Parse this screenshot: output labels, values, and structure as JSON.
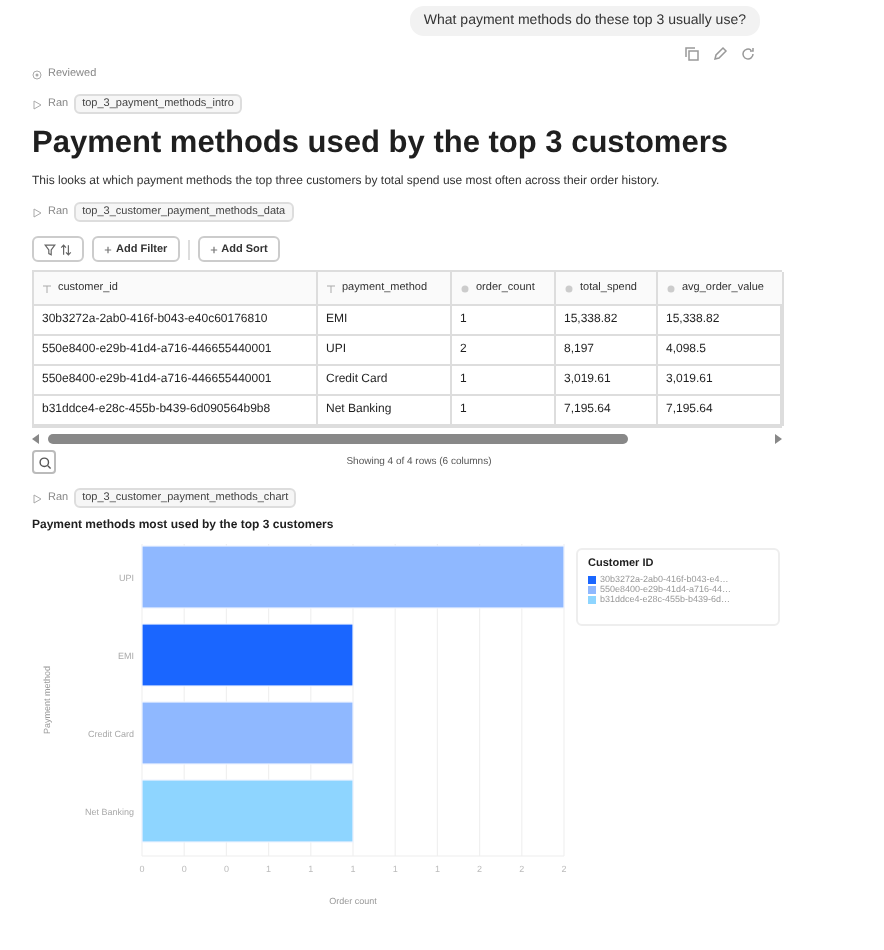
{
  "user_message": "What payment methods do these top 3 usually use?",
  "status": "Reviewed",
  "runs": [
    {
      "label": "Ran",
      "name": "top_3_payment_methods_intro"
    },
    {
      "label": "Ran",
      "name": "top_3_customer_payment_methods_data"
    },
    {
      "label": "Ran",
      "name": "top_3_customer_payment_methods_chart"
    }
  ],
  "heading": "Payment methods used by the top 3 customers",
  "intro": "This looks at which payment methods the top three customers by total spend use most often across their order history.",
  "toolbar": {
    "add_filter": "Add Filter",
    "add_sort": "Add Sort"
  },
  "table": {
    "columns": [
      {
        "name": "customer_id",
        "kind": "text"
      },
      {
        "name": "payment_method",
        "kind": "text"
      },
      {
        "name": "order_count",
        "kind": "number"
      },
      {
        "name": "total_spend",
        "kind": "number"
      },
      {
        "name": "avg_order_value",
        "kind": "number"
      }
    ],
    "rows": [
      [
        "30b3272a-2ab0-416f-b043-e40c60176810",
        "EMI",
        "1",
        "15,338.82",
        "15,338.82"
      ],
      [
        "550e8400-e29b-41d4-a716-446655440001",
        "UPI",
        "2",
        "8,197",
        "4,098.5"
      ],
      [
        "550e8400-e29b-41d4-a716-446655440001",
        "Credit Card",
        "1",
        "3,019.61",
        "3,019.61"
      ],
      [
        "b31ddce4-e28c-455b-b439-6d090564b9b8",
        "Net Banking",
        "1",
        "7,195.64",
        "7,195.64"
      ]
    ]
  },
  "table_footer": "Showing 4 of 4 rows (6 columns)",
  "chart_data": {
    "type": "bar",
    "orientation": "horizontal",
    "stacked": true,
    "title": "Payment methods most used by the top 3 customers",
    "xlabel": "Order count",
    "ylabel": "Payment method",
    "legend_title": "Customer ID",
    "categories": [
      "UPI",
      "EMI",
      "Credit Card",
      "Net Banking"
    ],
    "series": [
      {
        "name": "30b3272a-2ab0-416f-b043-e4…",
        "color": "#1a66ff",
        "values": [
          null,
          1,
          null,
          null
        ]
      },
      {
        "name": "550e8400-e29b-41d4-a716-44…",
        "color": "#8fb8ff",
        "values": [
          2,
          null,
          1,
          null
        ]
      },
      {
        "name": "b31ddce4-e28c-455b-b439-6d…",
        "color": "#8ed5ff",
        "values": [
          null,
          null,
          null,
          1
        ]
      }
    ],
    "xlim": [
      0,
      2
    ],
    "grid": true,
    "xticks": [
      {
        "value": 0,
        "label": "0"
      },
      {
        "value": 0.2,
        "label": "0"
      },
      {
        "value": 0.4,
        "label": "0"
      },
      {
        "value": 0.6,
        "label": "1"
      },
      {
        "value": 0.8,
        "label": "1"
      },
      {
        "value": 1,
        "label": "1"
      },
      {
        "value": 1.2,
        "label": "1"
      },
      {
        "value": 1.4,
        "label": "1"
      },
      {
        "value": 1.6,
        "label": "2"
      },
      {
        "value": 1.8,
        "label": "2"
      },
      {
        "value": 2,
        "label": "2"
      }
    ]
  }
}
